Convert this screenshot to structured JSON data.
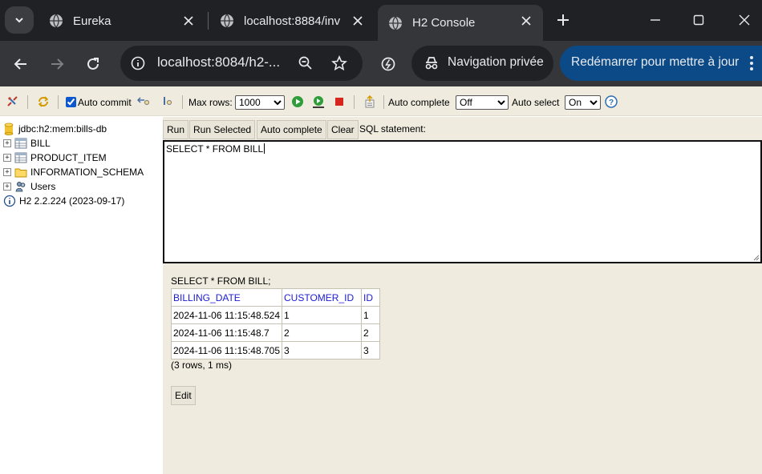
{
  "browser": {
    "tabs": [
      {
        "label": "Eureka",
        "active": false
      },
      {
        "label": "localhost:8884/inv",
        "active": false
      },
      {
        "label": "H2 Console",
        "active": true
      }
    ],
    "url": "localhost:8084/h2-...",
    "incognito_label": "Navigation privée",
    "restart_label": "Redémarrer pour mettre à jour"
  },
  "h2toolbar": {
    "auto_commit_label": "Auto commit",
    "auto_commit_checked": true,
    "max_rows_label": "Max rows:",
    "max_rows_value": "1000",
    "auto_complete_label": "Auto complete",
    "auto_complete_value": "Off",
    "auto_select_label": "Auto select",
    "auto_select_value": "On"
  },
  "tree": {
    "connection": "jdbc:h2:mem:bills-db",
    "items": [
      "BILL",
      "PRODUCT_ITEM",
      "INFORMATION_SCHEMA",
      "Users"
    ],
    "version": "H2 2.2.224 (2023-09-17)"
  },
  "query": {
    "buttons": {
      "run": "Run",
      "run_selected": "Run Selected",
      "auto_complete": "Auto complete",
      "clear": "Clear"
    },
    "sql_label": "SQL statement:",
    "sql": "SELECT * FROM BILL"
  },
  "result": {
    "statement": "SELECT * FROM BILL;",
    "columns": [
      "BILLING_DATE",
      "CUSTOMER_ID",
      "ID"
    ],
    "rows": [
      [
        "2024-11-06 11:15:48.524",
        "1",
        "1"
      ],
      [
        "2024-11-06 11:15:48.7",
        "2",
        "2"
      ],
      [
        "2024-11-06 11:15:48.705",
        "3",
        "3"
      ]
    ],
    "summary": "(3 rows, 1 ms)",
    "edit_label": "Edit"
  },
  "colors": {
    "chrome_dark": "#202124",
    "chrome_toolbar": "#35363a",
    "h2_bg": "#efebdf",
    "header_link": "#1b1bd8",
    "restart_bg": "#0b4a87"
  }
}
